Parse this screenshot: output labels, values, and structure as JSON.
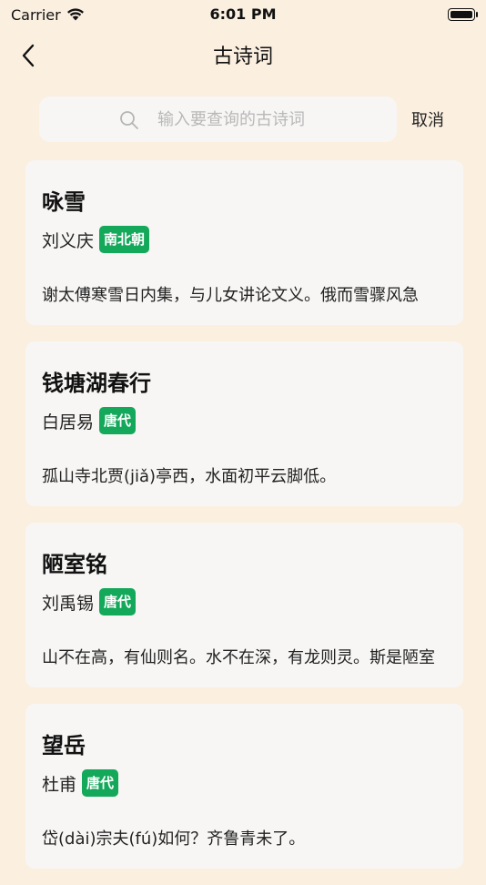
{
  "status": {
    "carrier": "Carrier",
    "time": "6:01 PM"
  },
  "nav": {
    "title": "古诗词"
  },
  "search": {
    "placeholder": "输入要查询的古诗词",
    "value": "",
    "cancel": "取消"
  },
  "poems": [
    {
      "title": "咏雪",
      "author": "刘义庆",
      "dynasty": "南北朝",
      "excerpt": "谢太傅寒雪日内集，与儿女讲论文义。俄而雪骤风急"
    },
    {
      "title": "钱塘湖春行",
      "author": "白居易",
      "dynasty": "唐代",
      "excerpt": "孤山寺北贾(jiǎ)亭西，水面初平云脚低。"
    },
    {
      "title": "陋室铭",
      "author": "刘禹锡",
      "dynasty": "唐代",
      "excerpt": "山不在高，有仙则名。水不在深，有龙则灵。斯是陋室"
    },
    {
      "title": "望岳",
      "author": "杜甫",
      "dynasty": "唐代",
      "excerpt": "岱(dài)宗夫(fú)如何？齐鲁青未了。"
    }
  ],
  "colors": {
    "background": "#FBEFE0",
    "card": "#F7F6F4",
    "badge": "#14A85A"
  }
}
